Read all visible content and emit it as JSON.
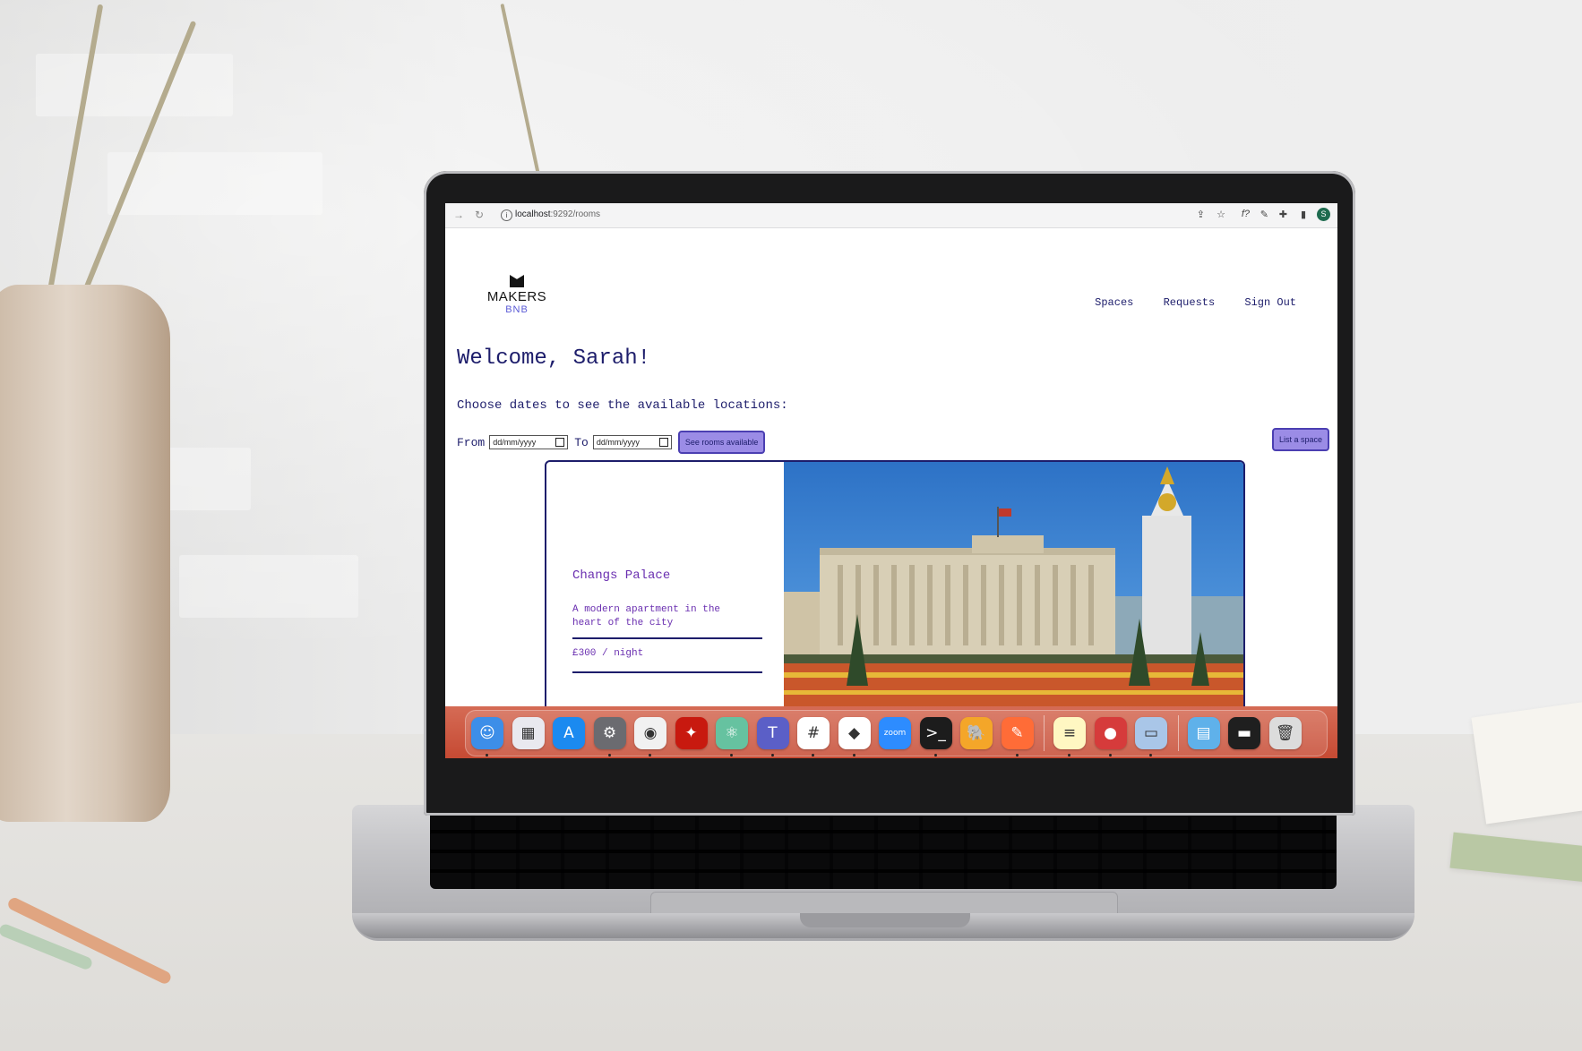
{
  "browser": {
    "url_host": "localhost",
    "url_path": ":9292/rooms",
    "profile_initial": "S"
  },
  "site": {
    "logo_top": "MAKERS",
    "logo_bottom": "BNB",
    "nav": [
      "Spaces",
      "Requests",
      "Sign Out"
    ]
  },
  "welcome": "Welcome, Sarah!",
  "prompt": "Choose dates to see the available locations:",
  "date_filter": {
    "from_label": "From",
    "to_label": "To",
    "from_placeholder": "dd/mm/yyyy",
    "to_placeholder": "dd/mm/yyyy",
    "submit_label": "See rooms available"
  },
  "list_space_label": "List a space",
  "room": {
    "name": "Changs Palace",
    "description": "A modern apartment in the heart of the city",
    "price": "£300 / night"
  },
  "dock": {
    "apps": [
      {
        "name": "finder-icon",
        "glyph": "☺",
        "bg": "#3d8ee8",
        "running": true
      },
      {
        "name": "launchpad-icon",
        "glyph": "▦",
        "bg": "#e9e9ef",
        "running": false
      },
      {
        "name": "app-store-icon",
        "glyph": "A",
        "bg": "#1b8af0",
        "running": false
      },
      {
        "name": "system-preferences-icon",
        "glyph": "⚙",
        "bg": "#6b6b70",
        "running": true
      },
      {
        "name": "chrome-icon",
        "glyph": "◉",
        "bg": "#f1f1f1",
        "running": true
      },
      {
        "name": "acrobat-icon",
        "glyph": "✦",
        "bg": "#c8190f",
        "running": false
      },
      {
        "name": "atom-icon",
        "glyph": "⚛",
        "bg": "#66c2a0",
        "running": true
      },
      {
        "name": "teams-icon",
        "glyph": "T",
        "bg": "#5b5fc7",
        "running": true
      },
      {
        "name": "slack-icon",
        "glyph": "#",
        "bg": "#ffffff",
        "running": true
      },
      {
        "name": "vscode-icon",
        "glyph": "◆",
        "bg": "#ffffff",
        "running": true
      },
      {
        "name": "zoom-icon",
        "glyph": "zoom",
        "bg": "#2d8cff",
        "running": false
      },
      {
        "name": "terminal-icon",
        "glyph": ">_",
        "bg": "#1c1c1c",
        "running": true
      },
      {
        "name": "tableplus-icon",
        "glyph": "🐘",
        "bg": "#f4a629",
        "running": false
      },
      {
        "name": "postman-icon",
        "glyph": "✎",
        "bg": "#ff6c37",
        "running": true
      },
      {
        "name": "notes-icon",
        "glyph": "≡",
        "bg": "#fff7c2",
        "running": true
      },
      {
        "name": "photo-booth-icon",
        "glyph": "●",
        "bg": "#d63b3b",
        "running": true
      },
      {
        "name": "preview-icon",
        "glyph": "▭",
        "bg": "#a9c6e8",
        "running": true
      },
      {
        "name": "downloads-folder-icon",
        "glyph": "▤",
        "bg": "#5fb1ea",
        "running": false
      },
      {
        "name": "screen-recording-icon",
        "glyph": "▬",
        "bg": "#1f1f1f",
        "running": false
      },
      {
        "name": "trash-icon",
        "glyph": "🗑",
        "bg": "#dcdcdc",
        "running": false
      }
    ]
  }
}
